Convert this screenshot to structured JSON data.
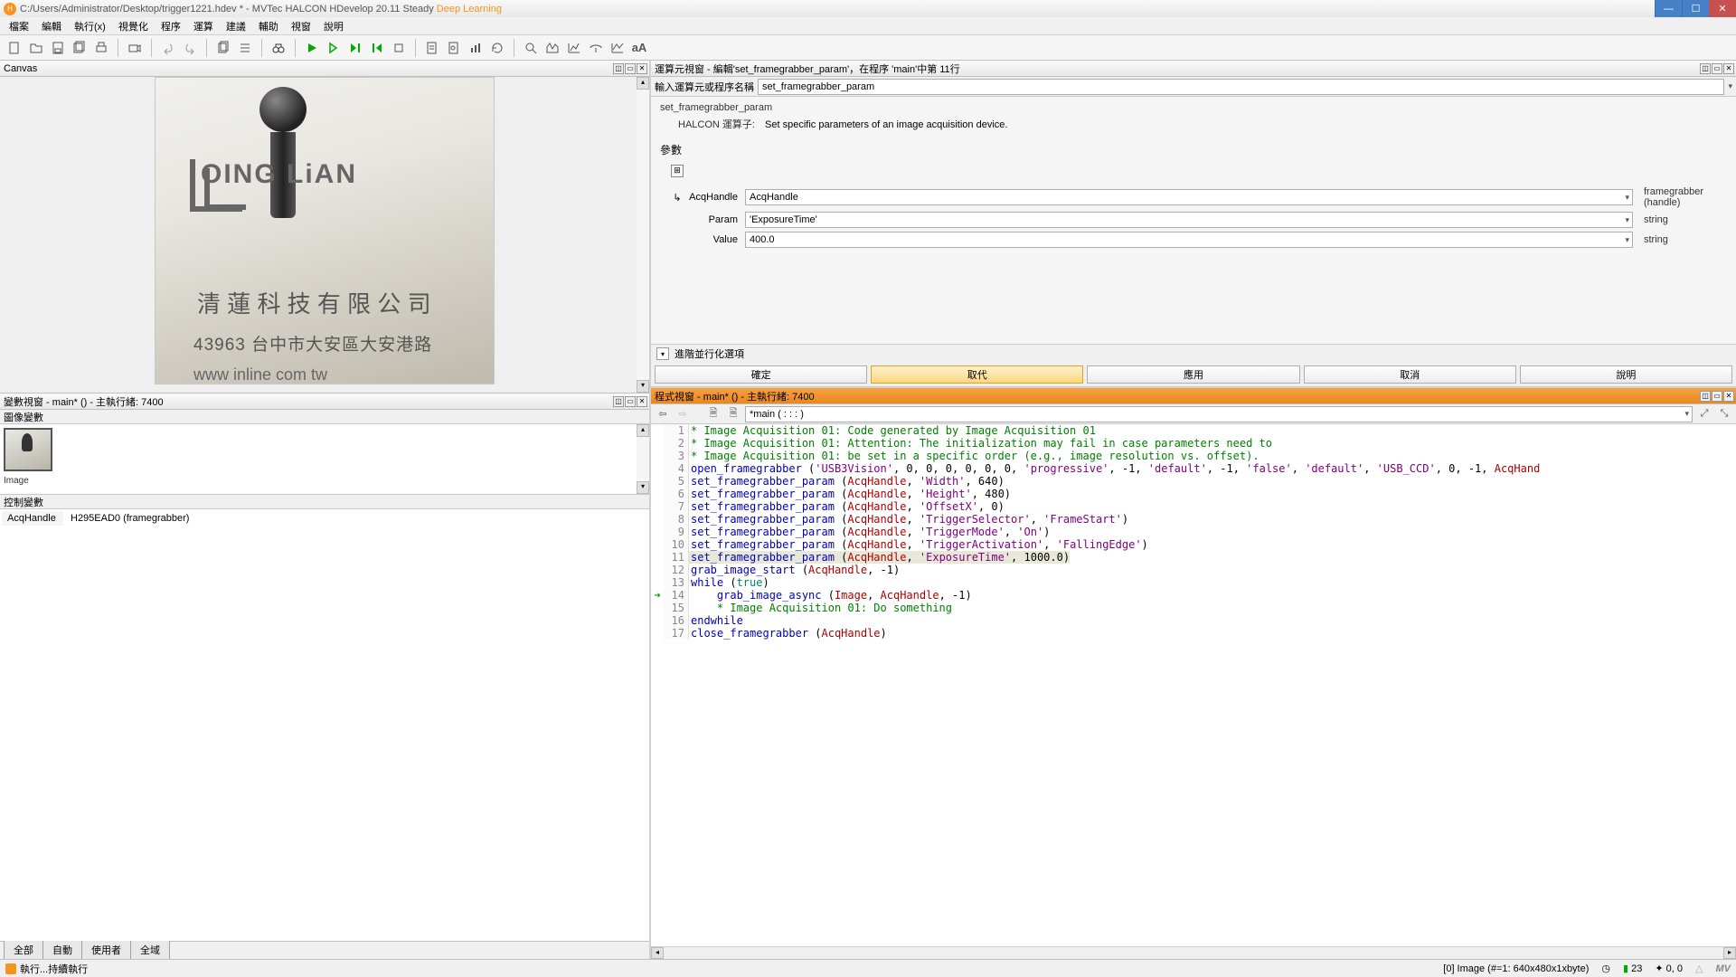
{
  "title": {
    "path": "C:/Users/Administrator/Desktop/trigger1221.hdev *",
    "app": "MVTec HALCON HDevelop 20.11 Steady",
    "suffix": "Deep Learning"
  },
  "menu": [
    "檔案",
    "編輯",
    "執行(x)",
    "視覺化",
    "程序",
    "運算",
    "建議",
    "輔助",
    "視窗",
    "說明"
  ],
  "panels": {
    "canvas": "Canvas",
    "varwin": "變數視窗 - main* () - 主執行緒: 7400",
    "imgvars": "圖像變數",
    "ctrlvars": "控制變數",
    "opwin": "運算元視窗 - 編輯'set_framegrabber_param'，在程序 'main'中第 11行",
    "codewin": "程式視窗 - main* () - 主執行緒: 7400"
  },
  "vartabs": [
    "全部",
    "自動",
    "使用者",
    "全域"
  ],
  "ctrlvar_rows": [
    {
      "name": "AcqHandle",
      "value": "H295EAD0 (framegrabber)"
    }
  ],
  "thumb_label": "Image",
  "op": {
    "search_label": "輸入運算元或程序名稱",
    "search_value": "set_framegrabber_param",
    "name": "set_framegrabber_param",
    "desc_label": "HALCON 運算子:",
    "desc": "Set specific parameters of an image acquisition device.",
    "params_hdr": "參數",
    "rows": [
      {
        "label": "AcqHandle",
        "value": "AcqHandle",
        "type": "framegrabber (handle)",
        "icon": "↳"
      },
      {
        "label": "Param",
        "value": "'ExposureTime'",
        "type": "string",
        "icon": ""
      },
      {
        "label": "Value",
        "value": "400.0",
        "type": "string",
        "icon": ""
      }
    ],
    "advanced": "進階並行化選項"
  },
  "buttons": {
    "ok": "確定",
    "replace": "取代",
    "apply": "應用",
    "cancel": "取消",
    "help": "說明"
  },
  "code": {
    "tab": "*main ( : : : )",
    "lines": [
      {
        "n": 1,
        "marker": "",
        "html": "<span class='c-green'>* Image Acquisition 01: Code generated by Image Acquisition 01</span>"
      },
      {
        "n": 2,
        "marker": "",
        "html": "<span class='c-green'>* Image Acquisition 01: Attention: The initialization may fail in case parameters need to</span>"
      },
      {
        "n": 3,
        "marker": "",
        "html": "<span class='c-green'>* Image Acquisition 01: be set in a specific order (e.g., image resolution vs. offset).</span>"
      },
      {
        "n": 4,
        "marker": "",
        "html": "<span class='c-blue'>open_framegrabber</span> (<span class='c-purple'>'USB3Vision'</span>, 0, 0, 0, 0, 0, 0, <span class='c-purple'>'progressive'</span>, -1, <span class='c-purple'>'default'</span>, -1, <span class='c-purple'>'false'</span>, <span class='c-purple'>'default'</span>, <span class='c-purple'>'USB_CCD'</span>, 0, -1, <span class='c-red'>AcqHand</span>"
      },
      {
        "n": 5,
        "marker": "",
        "html": "<span class='c-blue'>set_framegrabber_param</span> (<span class='c-red'>AcqHandle</span>, <span class='c-purple'>'Width'</span>, 640)"
      },
      {
        "n": 6,
        "marker": "",
        "html": "<span class='c-blue'>set_framegrabber_param</span> (<span class='c-red'>AcqHandle</span>, <span class='c-purple'>'Height'</span>, 480)"
      },
      {
        "n": 7,
        "marker": "",
        "html": "<span class='c-blue'>set_framegrabber_param</span> (<span class='c-red'>AcqHandle</span>, <span class='c-purple'>'OffsetX'</span>, 0)"
      },
      {
        "n": 8,
        "marker": "",
        "html": "<span class='c-blue'>set_framegrabber_param</span> (<span class='c-red'>AcqHandle</span>, <span class='c-purple'>'TriggerSelector'</span>, <span class='c-purple'>'FrameStart'</span>)"
      },
      {
        "n": 9,
        "marker": "",
        "html": "<span class='c-blue'>set_framegrabber_param</span> (<span class='c-red'>AcqHandle</span>, <span class='c-purple'>'TriggerMode'</span>, <span class='c-purple'>'On'</span>)"
      },
      {
        "n": 10,
        "marker": "",
        "html": "<span class='c-blue'>set_framegrabber_param</span> (<span class='c-red'>AcqHandle</span>, <span class='c-purple'>'TriggerActivation'</span>, <span class='c-purple'>'FallingEdge'</span>)"
      },
      {
        "n": 11,
        "marker": "",
        "hl": true,
        "html": "<span class='c-blue'>set_framegrabber_param</span> (<span class='c-red'>AcqHandle</span>, <span class='c-purple'>'ExposureTime'</span>, 1000.0)"
      },
      {
        "n": 12,
        "marker": "",
        "html": "<span class='c-blue'>grab_image_start</span> (<span class='c-red'>AcqHandle</span>, -1)"
      },
      {
        "n": 13,
        "marker": "",
        "html": "<span class='c-blue'>while</span> (<span class='c-teal'>true</span>)"
      },
      {
        "n": 14,
        "marker": "➜",
        "html": "    <span class='c-blue'>grab_image_async</span> (<span class='c-red'>Image</span>, <span class='c-red'>AcqHandle</span>, -1)"
      },
      {
        "n": 15,
        "marker": "",
        "html": "    <span class='c-green'>* Image Acquisition 01: Do something</span>"
      },
      {
        "n": 16,
        "marker": "",
        "html": "<span class='c-blue'>endwhile</span>"
      },
      {
        "n": 17,
        "marker": "",
        "html": "<span class='c-blue'>close_framegrabber</span> (<span class='c-red'>AcqHandle</span>)"
      }
    ]
  },
  "status": {
    "left": "執行...持續執行",
    "img": "[0] Image (#=1: 640x480x1xbyte)",
    "count": "23",
    "coord": "0, 0"
  },
  "fake_image": {
    "logo_text": "OING LiAN",
    "line1": "清 蓮 科 技 有 限 公 司",
    "line2": "43963 台中市大安區大安港路",
    "line3": "www inline com tw"
  }
}
